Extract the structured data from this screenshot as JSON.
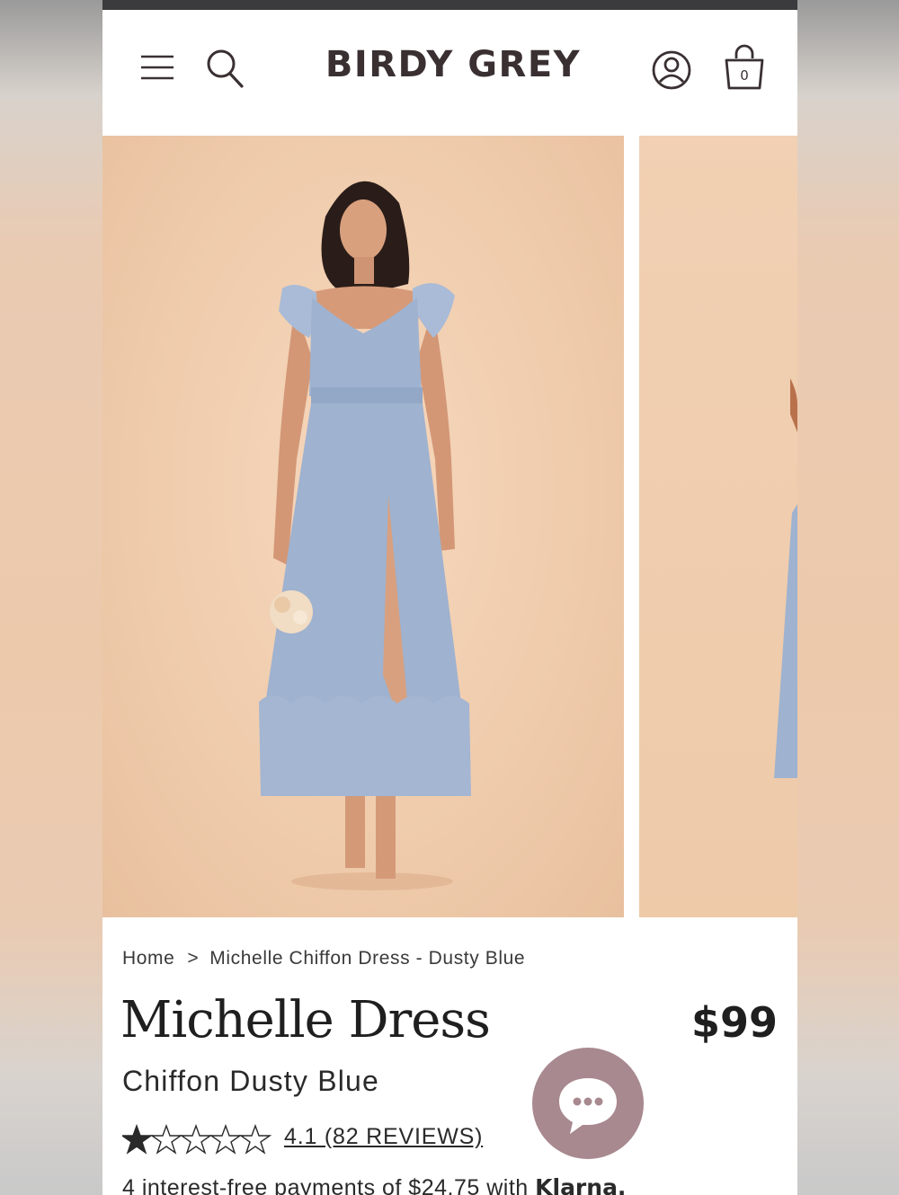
{
  "header": {
    "brand": "BIRDY GREY",
    "icons": [
      "menu-icon",
      "search-icon",
      "account-icon",
      "shopping-bag-icon"
    ],
    "cart_count": "0"
  },
  "product": {
    "image_alt": "Model wearing Michelle Chiffon Dress in Dusty Blue",
    "breadcrumb": [
      "Home",
      ">",
      "Michelle Chiffon Dress - Dusty Blue"
    ],
    "title": "Michelle Dress",
    "price": "$99",
    "subtitle": "Chiffon Dusty Blue",
    "rating": 4.1,
    "stars_out_of": 5,
    "reviews_label": "4.1 (82 REVIEWS)",
    "installments_text": "4 interest-free payments of $24.75 with ",
    "installments_provider": "Klarna."
  },
  "chat": {
    "icon": "chat-bubble-icon"
  },
  "colors": {
    "brand_text": "#3a3032",
    "backdrop": "#efcbab",
    "dress": "#9fb2cf",
    "chat_button": "#a8898f"
  }
}
